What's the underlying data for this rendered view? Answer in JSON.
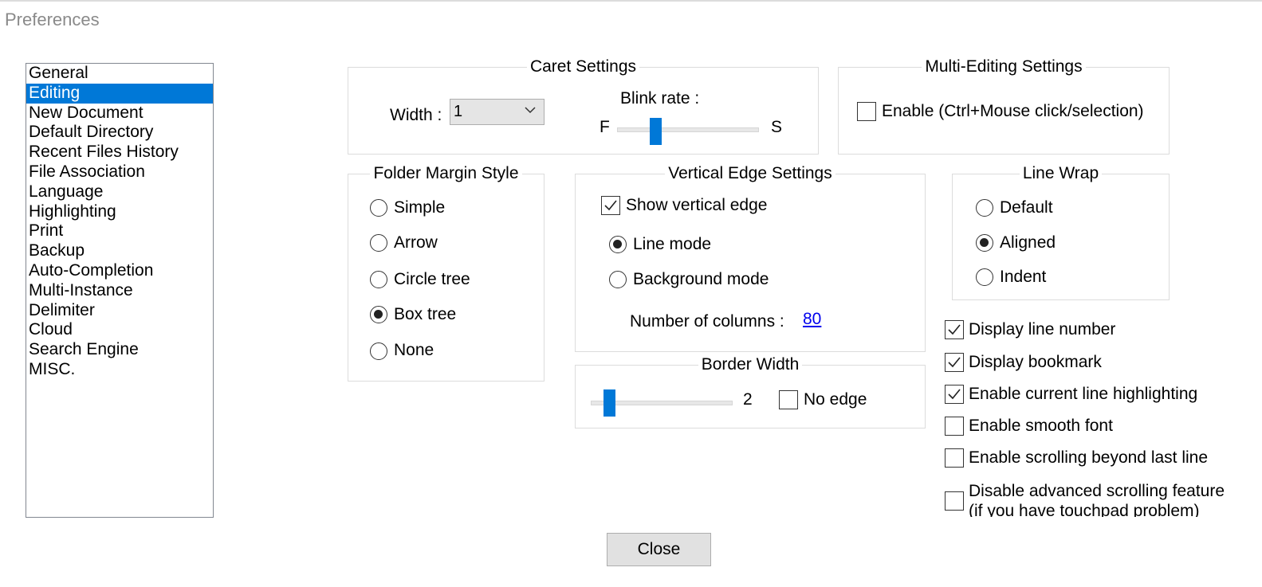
{
  "window": {
    "title": "Preferences"
  },
  "categories": [
    "General",
    "Editing",
    "New Document",
    "Default Directory",
    "Recent Files History",
    "File Association",
    "Language",
    "Highlighting",
    "Print",
    "Backup",
    "Auto-Completion",
    "Multi-Instance",
    "Delimiter",
    "Cloud",
    "Search Engine",
    "MISC."
  ],
  "selected_category": "Editing",
  "caret": {
    "title": "Caret Settings",
    "width_label": "Width :",
    "width_value": "1",
    "blink_label": "Blink rate :",
    "blink_fast": "F",
    "blink_slow": "S",
    "blink_level": 0.25
  },
  "multi_editing": {
    "title": "Multi-Editing Settings",
    "enable_label": "Enable (Ctrl+Mouse click/selection)",
    "enable_checked": false
  },
  "folder_margin": {
    "title": "Folder Margin Style",
    "options": [
      "Simple",
      "Arrow",
      "Circle tree",
      "Box tree",
      "None"
    ],
    "selected": "Box tree"
  },
  "vertical_edge": {
    "title": "Vertical Edge Settings",
    "show_label": "Show vertical edge",
    "show_checked": true,
    "line_mode": "Line mode",
    "background_mode": "Background mode",
    "selected_mode": "Line mode",
    "columns_label": "Number of columns :",
    "columns_value": "80"
  },
  "border_width": {
    "title": "Border Width",
    "value": "2",
    "level": 0.1,
    "no_edge_label": "No edge",
    "no_edge_checked": false
  },
  "line_wrap": {
    "title": "Line Wrap",
    "options": [
      "Default",
      "Aligned",
      "Indent"
    ],
    "selected": "Aligned"
  },
  "display_options": [
    {
      "label": "Display line number",
      "checked": true
    },
    {
      "label": "Display bookmark",
      "checked": true
    },
    {
      "label": "Enable current line highlighting",
      "checked": true
    },
    {
      "label": "Enable smooth font",
      "checked": false
    },
    {
      "label": "Enable scrolling beyond last line",
      "checked": false
    },
    {
      "label": "Disable advanced scrolling feature",
      "label2": "(if you have touchpad problem)",
      "checked": false
    }
  ],
  "close_label": "Close",
  "colors": {
    "accent": "#0078d7",
    "link": "#0000ee"
  },
  "icons": {
    "check": "checkmark-icon",
    "chevron": "chevron-down-icon"
  }
}
